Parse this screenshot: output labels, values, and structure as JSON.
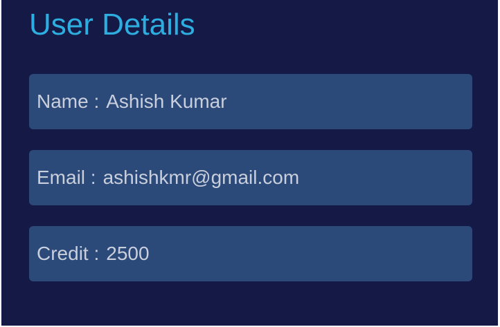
{
  "page": {
    "title": "User Details"
  },
  "fields": [
    {
      "label": "Name :",
      "value": "Ashish Kumar"
    },
    {
      "label": "Email :",
      "value": "ashishkmr@gmail.com"
    },
    {
      "label": "Credit :",
      "value": "2500"
    }
  ],
  "colors": {
    "background": "#141a45",
    "title": "#2eaee0",
    "field_background": "#2b4979",
    "field_text": "#c9cfdc"
  }
}
